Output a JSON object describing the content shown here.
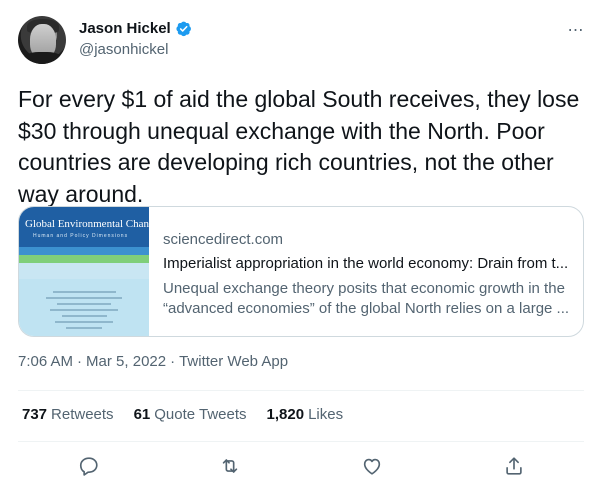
{
  "author": {
    "name": "Jason Hickel",
    "handle": "@jasonhickel"
  },
  "more_icon": "⋯",
  "tweet_text": "For every $1 of aid the global South receives, they lose $30 through unequal exchange with the North.  Poor countries are developing rich countries, not the other way around.",
  "card": {
    "thumbnail_title": "Global Environmental Change",
    "thumbnail_subtitle": "Human and Policy Dimensions",
    "domain": "sciencedirect.com",
    "title": "Imperialist appropriation in the world economy: Drain from t...",
    "description_line1": "Unequal exchange theory posits that economic growth in the",
    "description_line2": "“advanced economies” of the global North relies on a large ..."
  },
  "meta": {
    "time": "7:06 AM",
    "separator": "·",
    "date": "Mar 5, 2022",
    "app": "Twitter Web App"
  },
  "stats": {
    "retweets_count": "737",
    "retweets_label": "Retweets",
    "quote_count": "61",
    "quote_label": "Quote Tweets",
    "likes_count": "1,820",
    "likes_label": "Likes"
  },
  "icons": {
    "verified": "verified-badge-icon",
    "reply": "reply-icon",
    "retweet": "retweet-icon",
    "like": "heart-icon",
    "share": "share-icon"
  },
  "colors": {
    "verified_blue": "#1d9bf0",
    "text_primary": "#0f1419",
    "text_secondary": "#536471",
    "border": "#cfd9de"
  }
}
